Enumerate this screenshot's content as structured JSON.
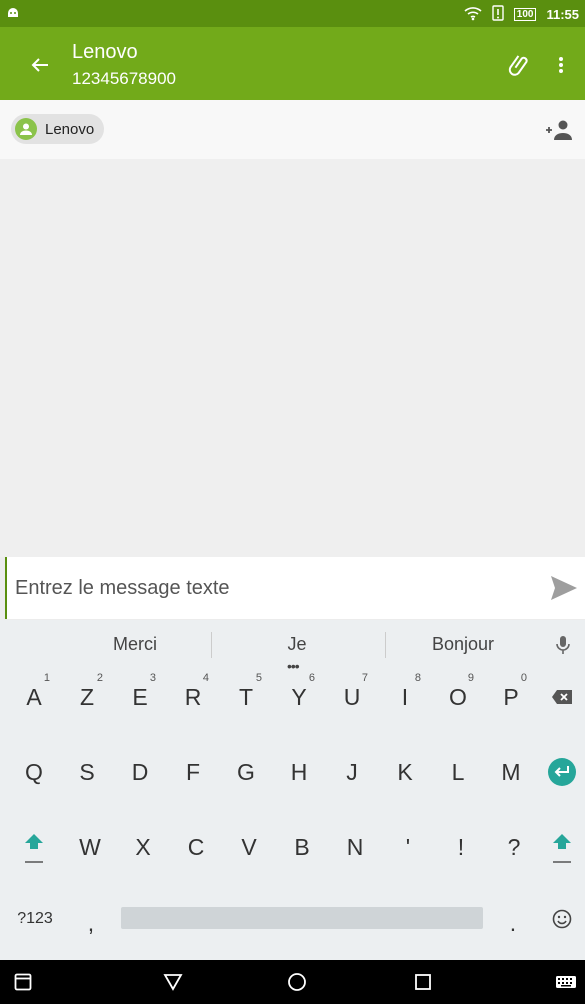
{
  "status_bar": {
    "time": "11:55",
    "battery": "100"
  },
  "app_bar": {
    "title": "Lenovo",
    "subtitle": "12345678900"
  },
  "recipient": {
    "name": "Lenovo",
    "add_label": "+"
  },
  "composer": {
    "placeholder": "Entrez le message texte"
  },
  "keyboard": {
    "suggestions": [
      "Merci",
      "Je",
      "Bonjour"
    ],
    "row1": [
      {
        "k": "A",
        "h": "1"
      },
      {
        "k": "Z",
        "h": "2"
      },
      {
        "k": "E",
        "h": "3"
      },
      {
        "k": "R",
        "h": "4"
      },
      {
        "k": "T",
        "h": "5"
      },
      {
        "k": "Y",
        "h": "6"
      },
      {
        "k": "U",
        "h": "7"
      },
      {
        "k": "I",
        "h": "8"
      },
      {
        "k": "O",
        "h": "9"
      },
      {
        "k": "P",
        "h": "0"
      }
    ],
    "row2": [
      "Q",
      "S",
      "D",
      "F",
      "G",
      "H",
      "J",
      "K",
      "L",
      "M"
    ],
    "row3": [
      "W",
      "X",
      "C",
      "V",
      "B",
      "N",
      "'",
      "!",
      "?"
    ],
    "row4": {
      "symbols": "?123",
      "comma": ",",
      "period": "."
    }
  },
  "colors": {
    "accent": "#72aa1a",
    "status": "#5a8f0f",
    "key_accent": "#26a69a"
  }
}
